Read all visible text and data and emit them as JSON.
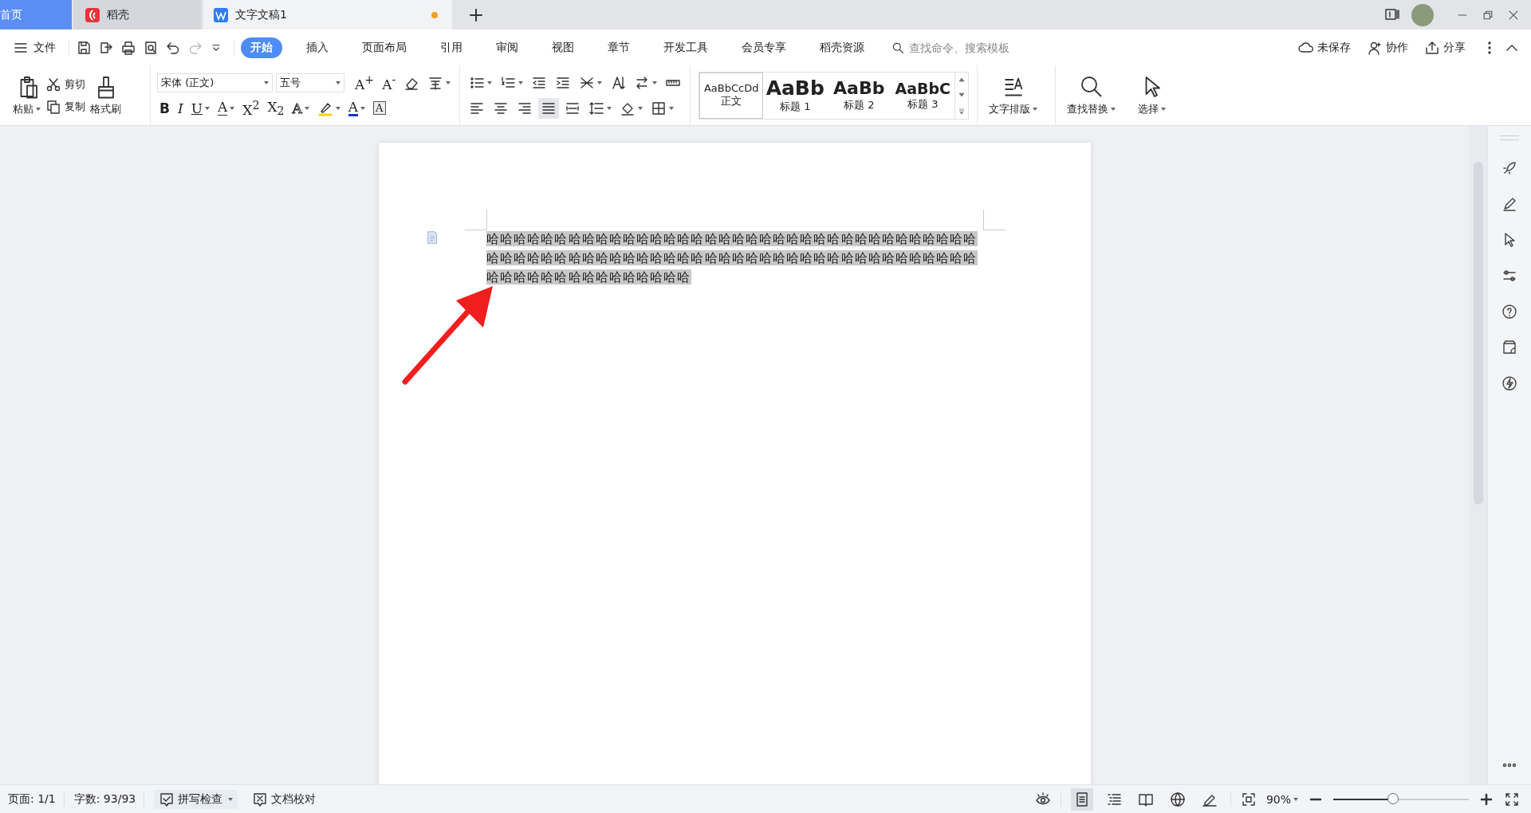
{
  "tabs": [
    {
      "label": "首页",
      "kind": "home",
      "selected": false,
      "modified": false
    },
    {
      "label": "稻壳",
      "kind": "docer",
      "selected": false,
      "modified": false
    },
    {
      "label": "文字文稿1",
      "kind": "writer",
      "selected": true,
      "modified": true
    }
  ],
  "menu": {
    "file": "文件",
    "ribbon_tabs": [
      {
        "label": "开始",
        "selected": true
      },
      {
        "label": "插入",
        "selected": false
      },
      {
        "label": "页面布局",
        "selected": false
      },
      {
        "label": "引用",
        "selected": false
      },
      {
        "label": "审阅",
        "selected": false
      },
      {
        "label": "视图",
        "selected": false
      },
      {
        "label": "章节",
        "selected": false
      },
      {
        "label": "开发工具",
        "selected": false
      },
      {
        "label": "会员专享",
        "selected": false
      },
      {
        "label": "稻壳资源",
        "selected": false
      }
    ],
    "search": {
      "placeholder": "查找命令、搜索模板"
    },
    "actions": [
      {
        "label": "未保存",
        "kind": "cloud"
      },
      {
        "label": "协作",
        "kind": "user"
      },
      {
        "label": "分享",
        "kind": "share"
      }
    ]
  },
  "ribbon": {
    "paste": "粘贴",
    "cut": "剪切",
    "copy": "复制",
    "format_painter": "格式刷",
    "font": "宋体 (正文)",
    "size": "五号",
    "font_row_1": [
      {
        "kind": "grow",
        "label": "A$^{+}$"
      },
      {
        "kind": "shrink",
        "label": "A$^{-}$"
      },
      {
        "kind": "eraser"
      },
      {
        "kind": "phonetic",
        "dropdown": true
      }
    ],
    "font_row_2": [
      {
        "kind": "bold",
        "label": "B"
      },
      {
        "kind": "italic",
        "label": "I"
      },
      {
        "kind": "underline",
        "label": "U",
        "dropdown": true
      },
      {
        "kind": "strike",
        "label": "A",
        "dropdown": true
      },
      {
        "kind": "plain",
        "label": "X$^{2}$"
      },
      {
        "kind": "plain",
        "label": "X$_{2}$"
      },
      {
        "kind": "outline",
        "label": "A",
        "dropdown": true
      },
      {
        "kind": "highlight",
        "dropdown": true
      },
      {
        "kind": "color",
        "label": "A",
        "dropdown": true
      },
      {
        "kind": "boxed",
        "label": "A"
      }
    ],
    "para_row_1": [
      {
        "kind": "bullets",
        "dropdown": true
      },
      {
        "kind": "numbering",
        "dropdown": true
      },
      {
        "kind": "outdent"
      },
      {
        "kind": "indent"
      },
      {
        "kind": "layout",
        "dropdown": true
      },
      {
        "kind": "sort"
      },
      {
        "kind": "direction",
        "dropdown": true
      },
      {
        "kind": "ruler"
      }
    ],
    "para_row_2": [
      {
        "kind": "align-left",
        "selected": false
      },
      {
        "kind": "align-center",
        "selected": false
      },
      {
        "kind": "align-right",
        "selected": false
      },
      {
        "kind": "justify",
        "selected": true
      },
      {
        "kind": "distribute",
        "selected": false
      },
      {
        "kind": "line-spacing",
        "dropdown": true
      },
      {
        "kind": "shading",
        "dropdown": true
      },
      {
        "kind": "borders",
        "dropdown": true
      }
    ],
    "styles": [
      {
        "preview": "AaBbCcDd",
        "label": "正文",
        "selected": true
      },
      {
        "preview": "AaBb",
        "label": "标题 1",
        "selected": false
      },
      {
        "preview": "AaBb",
        "label": "标题 2",
        "selected": false
      },
      {
        "preview": "AaBbC",
        "label": "标题 3",
        "selected": false
      }
    ],
    "big_buttons": [
      {
        "label": "文字排版",
        "kind": "typeset"
      },
      {
        "label": "查找替换",
        "kind": "find"
      },
      {
        "label": "选择",
        "kind": "select"
      }
    ]
  },
  "document": {
    "text": "哈哈哈哈哈哈哈哈哈哈哈哈哈哈哈哈哈哈哈哈哈哈哈哈哈哈哈哈哈哈哈哈哈哈哈哈哈哈哈哈哈哈哈哈哈哈哈哈哈哈哈哈哈哈哈哈哈哈哈哈哈哈哈哈哈哈哈哈哈哈哈哈哈哈哈哈哈哈哈哈哈哈哈哈哈哈哈",
    "selected": true
  },
  "status_bar": {
    "page": "页面: 1/1",
    "words": "字数: 93/93",
    "spell_check": "拼写检查",
    "proofread": "文档校对",
    "view_modes": [
      {
        "kind": "page",
        "selected": true
      },
      {
        "kind": "outline",
        "selected": false
      },
      {
        "kind": "reading",
        "selected": false
      },
      {
        "kind": "web",
        "selected": false
      },
      {
        "kind": "edit",
        "selected": false
      }
    ],
    "zoom": {
      "label": "90%",
      "level": 0.44
    }
  }
}
